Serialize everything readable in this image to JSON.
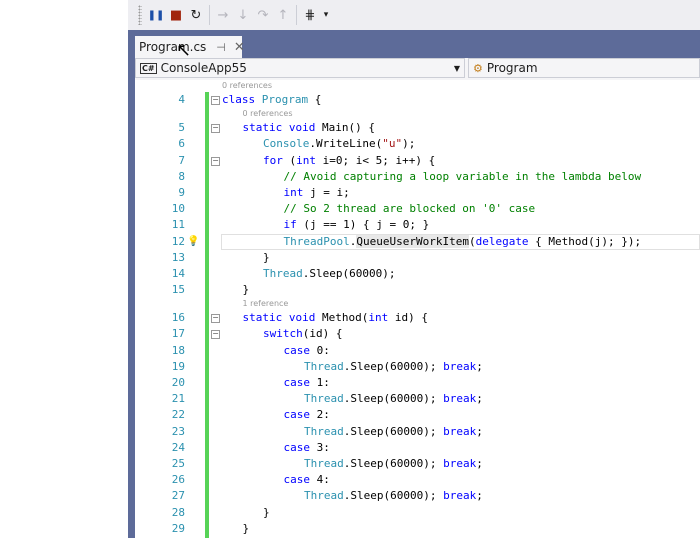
{
  "toolbar": {
    "buttons": [
      {
        "name": "break-all",
        "icon": "pause-icon",
        "glyph": "❚❚",
        "enabled": true
      },
      {
        "name": "stop-debugging",
        "icon": "stop-icon",
        "glyph": "■",
        "enabled": true
      },
      {
        "name": "restart",
        "icon": "restart-icon",
        "glyph": "↻",
        "enabled": true
      },
      {
        "name": "show-next-statement",
        "icon": "arrow-right-icon",
        "glyph": "→",
        "enabled": false
      },
      {
        "name": "step-into",
        "icon": "step-into-icon",
        "glyph": "↓",
        "enabled": false
      },
      {
        "name": "step-over",
        "icon": "step-over-icon",
        "glyph": "↷",
        "enabled": false
      },
      {
        "name": "step-out",
        "icon": "step-out-icon",
        "glyph": "↑",
        "enabled": false
      },
      {
        "name": "threads",
        "icon": "threads-icon",
        "glyph": "⋕",
        "enabled": true
      }
    ]
  },
  "tab": {
    "label": "Program.cs",
    "pin_icon": "pin-icon",
    "close_icon": "close-icon"
  },
  "nav": {
    "project": "ConsoleApp55",
    "project_badge": "C#",
    "type": "Program"
  },
  "colors": {
    "keyword": "#0000ff",
    "type": "#2b91af",
    "comment": "#008000",
    "string": "#a31515",
    "change_bar": "#57d357"
  },
  "lines": [
    {
      "lens": "0 references",
      "lensIndent": 0
    },
    {
      "num": "4",
      "fold": true,
      "indent": 0,
      "tokens": [
        {
          "t": "class ",
          "c": "kw"
        },
        {
          "t": "Program",
          "c": "ty"
        },
        {
          "t": " {",
          "c": "tx"
        }
      ]
    },
    {
      "lens": "0 references",
      "lensIndent": 1
    },
    {
      "num": "5",
      "fold": true,
      "indent": 1,
      "tokens": [
        {
          "t": "static void ",
          "c": "kw"
        },
        {
          "t": "Main() {",
          "c": "tx"
        }
      ]
    },
    {
      "num": "6",
      "indent": 2,
      "tokens": [
        {
          "t": "Console",
          "c": "ty"
        },
        {
          "t": ".WriteLine(",
          "c": "tx"
        },
        {
          "t": "\"u\"",
          "c": "st"
        },
        {
          "t": ");",
          "c": "tx"
        }
      ]
    },
    {
      "num": "7",
      "fold": true,
      "indent": 2,
      "tokens": [
        {
          "t": "for",
          "c": "kw"
        },
        {
          "t": " (",
          "c": "tx"
        },
        {
          "t": "int",
          "c": "kw"
        },
        {
          "t": " i=0; i< 5; i++) {",
          "c": "tx"
        }
      ]
    },
    {
      "num": "8",
      "indent": 3,
      "tokens": [
        {
          "t": "// Avoid capturing a loop variable in the lambda below",
          "c": "cm"
        }
      ]
    },
    {
      "num": "9",
      "indent": 3,
      "tokens": [
        {
          "t": "int",
          "c": "kw"
        },
        {
          "t": " j = i;",
          "c": "tx"
        }
      ]
    },
    {
      "num": "10",
      "indent": 3,
      "tokens": [
        {
          "t": "// So 2 thread are blocked on '0' case",
          "c": "cm"
        }
      ]
    },
    {
      "num": "11",
      "indent": 3,
      "tokens": [
        {
          "t": "if",
          "c": "kw"
        },
        {
          "t": " (j == 1) { j = 0; }",
          "c": "tx"
        }
      ]
    },
    {
      "num": "12",
      "indent": 3,
      "current": true,
      "bulb": true,
      "tokens": [
        {
          "t": "ThreadPool",
          "c": "ty"
        },
        {
          "t": ".",
          "c": "tx"
        },
        {
          "t": "QueueUserWorkItem",
          "c": "tx hl"
        },
        {
          "t": "(",
          "c": "tx"
        },
        {
          "t": "delegate",
          "c": "kw"
        },
        {
          "t": " { Method(j); });",
          "c": "tx"
        }
      ]
    },
    {
      "num": "13",
      "indent": 2,
      "tokens": [
        {
          "t": "}",
          "c": "tx"
        }
      ]
    },
    {
      "num": "14",
      "indent": 2,
      "tokens": [
        {
          "t": "Thread",
          "c": "ty"
        },
        {
          "t": ".Sleep(60000);",
          "c": "tx"
        }
      ]
    },
    {
      "num": "15",
      "indent": 1,
      "tokens": [
        {
          "t": "}",
          "c": "tx"
        }
      ]
    },
    {
      "lens": "1 reference",
      "lensIndent": 1
    },
    {
      "num": "16",
      "fold": true,
      "indent": 1,
      "tokens": [
        {
          "t": "static void ",
          "c": "kw"
        },
        {
          "t": "Method(",
          "c": "tx"
        },
        {
          "t": "int",
          "c": "kw"
        },
        {
          "t": " id) {",
          "c": "tx"
        }
      ]
    },
    {
      "num": "17",
      "fold": true,
      "indent": 2,
      "tokens": [
        {
          "t": "switch",
          "c": "kw"
        },
        {
          "t": "(id) {",
          "c": "tx"
        }
      ]
    },
    {
      "num": "18",
      "indent": 3,
      "tokens": [
        {
          "t": "case",
          "c": "kw"
        },
        {
          "t": " 0:",
          "c": "tx"
        }
      ]
    },
    {
      "num": "19",
      "indent": 4,
      "tokens": [
        {
          "t": "Thread",
          "c": "ty"
        },
        {
          "t": ".Sleep(60000); ",
          "c": "tx"
        },
        {
          "t": "break",
          "c": "kw"
        },
        {
          "t": ";",
          "c": "tx"
        }
      ]
    },
    {
      "num": "20",
      "indent": 3,
      "tokens": [
        {
          "t": "case",
          "c": "kw"
        },
        {
          "t": " 1:",
          "c": "tx"
        }
      ]
    },
    {
      "num": "21",
      "indent": 4,
      "tokens": [
        {
          "t": "Thread",
          "c": "ty"
        },
        {
          "t": ".Sleep(60000); ",
          "c": "tx"
        },
        {
          "t": "break",
          "c": "kw"
        },
        {
          "t": ";",
          "c": "tx"
        }
      ]
    },
    {
      "num": "22",
      "indent": 3,
      "tokens": [
        {
          "t": "case",
          "c": "kw"
        },
        {
          "t": " 2:",
          "c": "tx"
        }
      ]
    },
    {
      "num": "23",
      "indent": 4,
      "tokens": [
        {
          "t": "Thread",
          "c": "ty"
        },
        {
          "t": ".Sleep(60000); ",
          "c": "tx"
        },
        {
          "t": "break",
          "c": "kw"
        },
        {
          "t": ";",
          "c": "tx"
        }
      ]
    },
    {
      "num": "24",
      "indent": 3,
      "tokens": [
        {
          "t": "case",
          "c": "kw"
        },
        {
          "t": " 3:",
          "c": "tx"
        }
      ]
    },
    {
      "num": "25",
      "indent": 4,
      "tokens": [
        {
          "t": "Thread",
          "c": "ty"
        },
        {
          "t": ".Sleep(60000); ",
          "c": "tx"
        },
        {
          "t": "break",
          "c": "kw"
        },
        {
          "t": ";",
          "c": "tx"
        }
      ]
    },
    {
      "num": "26",
      "indent": 3,
      "tokens": [
        {
          "t": "case",
          "c": "kw"
        },
        {
          "t": " 4:",
          "c": "tx"
        }
      ]
    },
    {
      "num": "27",
      "indent": 4,
      "tokens": [
        {
          "t": "Thread",
          "c": "ty"
        },
        {
          "t": ".Sleep(60000); ",
          "c": "tx"
        },
        {
          "t": "break",
          "c": "kw"
        },
        {
          "t": ";",
          "c": "tx"
        }
      ]
    },
    {
      "num": "28",
      "indent": 2,
      "tokens": [
        {
          "t": "}",
          "c": "tx"
        }
      ]
    },
    {
      "num": "29",
      "indent": 1,
      "tokens": [
        {
          "t": "}",
          "c": "tx"
        }
      ]
    }
  ]
}
